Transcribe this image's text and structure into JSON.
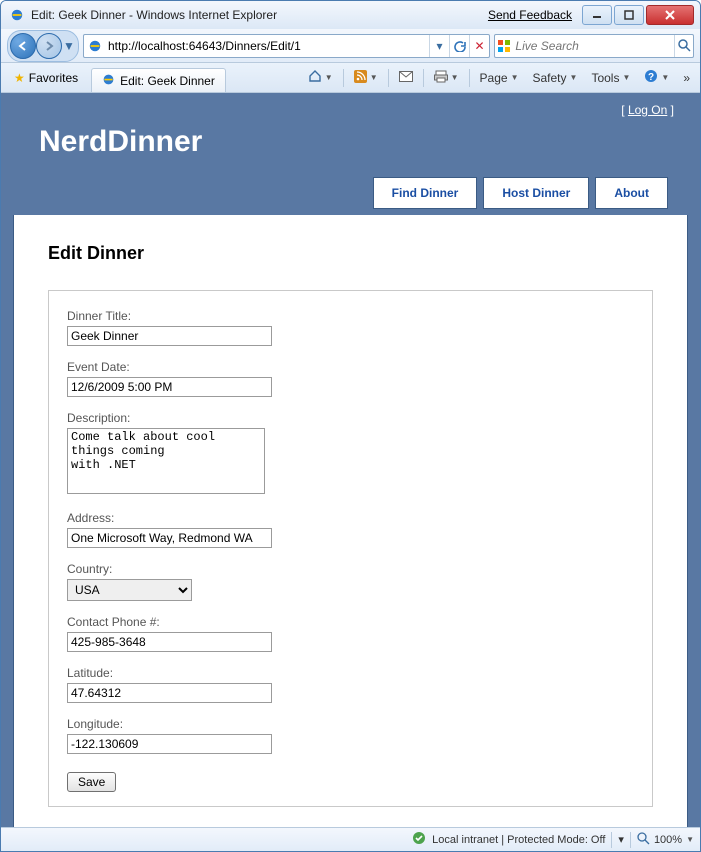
{
  "window": {
    "title": "Edit: Geek Dinner - Windows Internet Explorer",
    "send_feedback": "Send Feedback"
  },
  "address_bar": {
    "url": "http://localhost:64643/Dinners/Edit/1"
  },
  "search": {
    "placeholder": "Live Search"
  },
  "favorites": {
    "label": "Favorites"
  },
  "tab": {
    "title": "Edit: Geek Dinner"
  },
  "command_bar": {
    "page": "Page",
    "safety": "Safety",
    "tools": "Tools"
  },
  "site": {
    "logon": "Log On",
    "brand": "NerdDinner",
    "nav": {
      "find": "Find Dinner",
      "host": "Host Dinner",
      "about": "About"
    }
  },
  "page": {
    "heading": "Edit Dinner",
    "fields": {
      "title_label": "Dinner Title:",
      "title_value": "Geek Dinner",
      "date_label": "Event Date:",
      "date_value": "12/6/2009 5:00 PM",
      "desc_label": "Description:",
      "desc_value": "Come talk about cool things coming\nwith .NET",
      "address_label": "Address:",
      "address_value": "One Microsoft Way, Redmond WA",
      "country_label": "Country:",
      "country_value": "USA",
      "phone_label": "Contact Phone #:",
      "phone_value": "425-985-3648",
      "lat_label": "Latitude:",
      "lat_value": "47.64312",
      "lon_label": "Longitude:",
      "lon_value": "-122.130609"
    },
    "save": "Save"
  },
  "status": {
    "zone": "Local intranet | Protected Mode: Off",
    "zoom": "100%"
  }
}
